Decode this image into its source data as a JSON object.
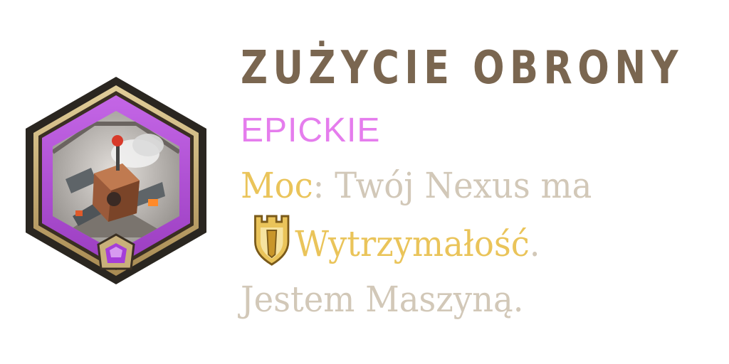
{
  "card": {
    "title": "ZUŻYCIE OBRONY",
    "rarity": "EPICKIE",
    "rarity_color": "#e57ded",
    "art_icon": "cannon-machine-art",
    "rarity_gem_icon": "epic-pentagon-gem-icon",
    "description": {
      "keyword_power": "Moc",
      "colon": ":",
      "text_1": " Twój Nexus ma",
      "keyword_icon": "tough-tower-shield-icon",
      "keyword_tough": "Wytrzymałość",
      "period": ".",
      "text_2": "Jestem Maszyną."
    }
  },
  "colors": {
    "title": "#7a6650",
    "body": "#d2c8b8",
    "keyword": "#eac45a",
    "frame_gold": "#c9b07a",
    "frame_purple": "#b84fd6"
  }
}
